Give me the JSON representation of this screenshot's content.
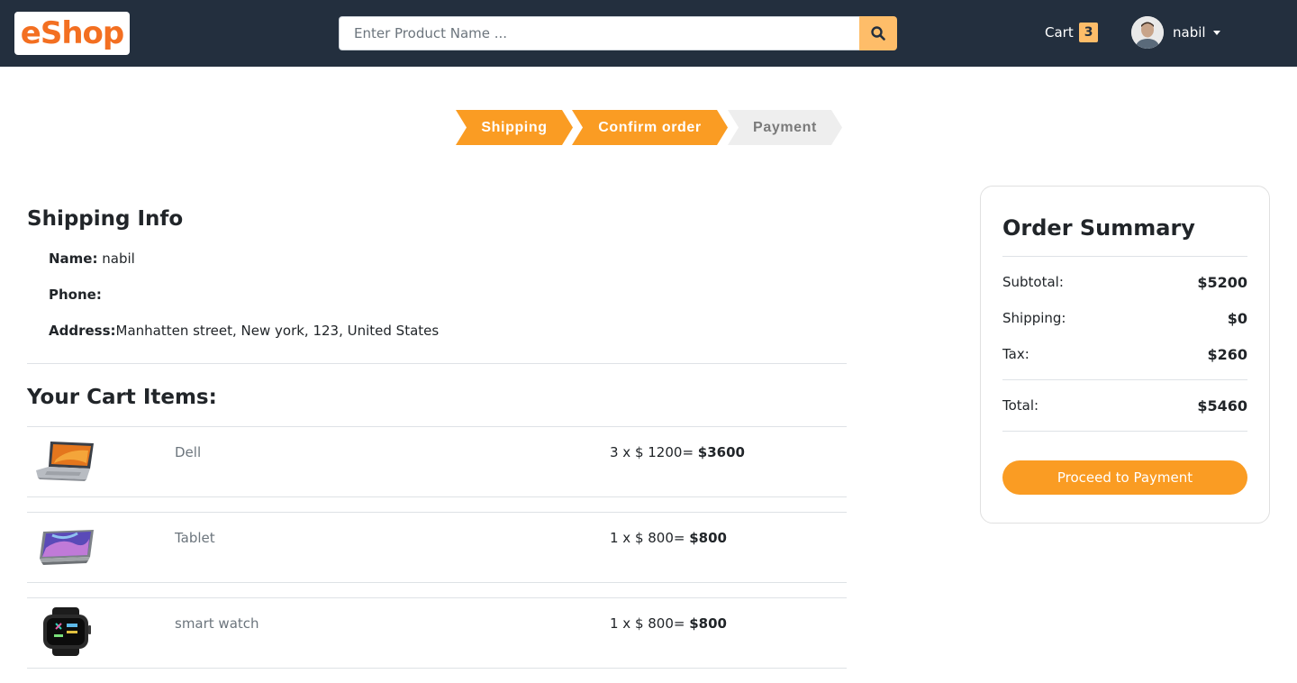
{
  "header": {
    "logo_text": "Shop",
    "logo_accent": "e",
    "search_placeholder": "Enter Product Name ...",
    "cart_label": "Cart",
    "cart_count": "3",
    "user_name": "nabil"
  },
  "steps": [
    {
      "label": "Shipping",
      "active": true
    },
    {
      "label": "Confirm order",
      "active": true
    },
    {
      "label": "Payment",
      "active": false
    }
  ],
  "shipping": {
    "title": "Shipping Info",
    "name_label": "Name:",
    "name_value": "nabil",
    "phone_label": "Phone:",
    "phone_value": "",
    "address_label": "Address:",
    "address_value": "Manhatten street, New york, 123, United States"
  },
  "cart": {
    "title": "Your Cart Items:",
    "items": [
      {
        "name": "Dell",
        "qty_text": "3 x $ 1200= ",
        "total": "$3600",
        "icon": "laptop-icon"
      },
      {
        "name": "Tablet",
        "qty_text": "1 x $ 800= ",
        "total": "$800",
        "icon": "tablet-icon"
      },
      {
        "name": "smart watch",
        "qty_text": "1 x $ 800= ",
        "total": "$800",
        "icon": "smartwatch-icon"
      }
    ]
  },
  "summary": {
    "title": "Order Summary",
    "subtotal_label": "Subtotal:",
    "subtotal_value": "$5200",
    "shipping_label": "Shipping:",
    "shipping_value": "$0",
    "tax_label": "Tax:",
    "tax_value": "$260",
    "total_label": "Total:",
    "total_value": "$5460",
    "button_label": "Proceed to Payment"
  },
  "colors": {
    "navbar": "#232f3e",
    "accent": "#febd69",
    "step_active": "#fa9c23",
    "step_inactive": "#eeeeee",
    "logo": "#f36f21"
  }
}
